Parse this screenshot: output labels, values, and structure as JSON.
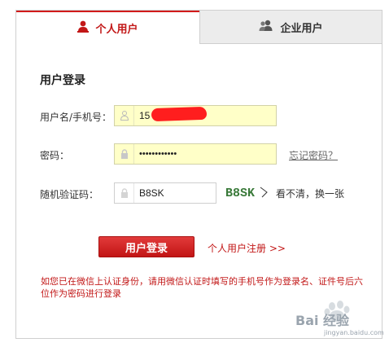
{
  "tabs": {
    "personal": {
      "label": "个人用户",
      "icon": "person-icon"
    },
    "enterprise": {
      "label": "企业用户",
      "icon": "group-icon"
    }
  },
  "login": {
    "title": "用户登录",
    "username_label": "用户名/手机号：",
    "username_value": "15",
    "password_label": "密码：",
    "password_value": "••••••••••••",
    "forgot_link": "忘记密码？",
    "captcha_label": "随机验证码：",
    "captcha_value": "B8SK",
    "captcha_image_text": "B8SK",
    "refresh_text": "看不清，换一张",
    "login_button": "用户登录",
    "register_link": "个人用户注册 >>",
    "notice": "如您已在微信上认证身份，请用微信认证时填写的手机号作为登录名、证件号后六位作为密码进行登录"
  },
  "watermark": {
    "text": "Bai 经验",
    "sub": "jingyan.baidu.com"
  },
  "colors": {
    "accent": "#c21717",
    "input_highlight": "#ffffc8",
    "tab_inactive": "#ececec"
  }
}
